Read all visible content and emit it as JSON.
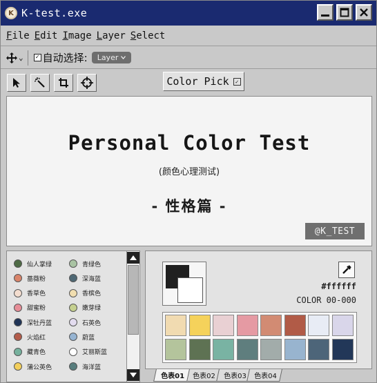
{
  "window": {
    "app_icon_letter": "K",
    "title": "K-test.exe",
    "controls": [
      "minimize",
      "maximize",
      "close"
    ]
  },
  "menu": {
    "items": [
      {
        "u": "F",
        "rest": "ile"
      },
      {
        "u": "E",
        "rest": "dit"
      },
      {
        "u": "I",
        "rest": "mage"
      },
      {
        "u": "L",
        "rest": "ayer"
      },
      {
        "u": "S",
        "rest": "elect"
      }
    ]
  },
  "options": {
    "move_caret": "⌄",
    "checkbox_mark": "✓",
    "auto_select_label": "自动选择:",
    "layer_value": "Layer"
  },
  "tools": {
    "items": [
      "pointer-icon",
      "magic-wand-icon",
      "crop-icon",
      "target-icon"
    ],
    "color_pick_label": "Color Pick"
  },
  "canvas": {
    "title": "Personal Color Test",
    "subtitle": "(颜色心理测试)",
    "chapter": "- 性格篇 -",
    "tag": "@K_TEST"
  },
  "color_list": [
    {
      "name": "仙人掌绿",
      "color": "#4d6a44"
    },
    {
      "name": "青绿色",
      "color": "#a9c3a3"
    },
    {
      "name": "蔷薇粉",
      "color": "#d9846a"
    },
    {
      "name": "深海蓝",
      "color": "#4e6874"
    },
    {
      "name": "香草色",
      "color": "#f3ddcf"
    },
    {
      "name": "香槟色",
      "color": "#f1deb0"
    },
    {
      "name": "甜蜜粉",
      "color": "#e68d97"
    },
    {
      "name": "嫩芽绿",
      "color": "#c5d08f"
    },
    {
      "name": "深牡丹蓝",
      "color": "#1f3356"
    },
    {
      "name": "石英色",
      "color": "#e3dcef"
    },
    {
      "name": "火焰红",
      "color": "#b35c4a"
    },
    {
      "name": "蔚蓝",
      "color": "#96b4d2"
    },
    {
      "name": "藏青色",
      "color": "#76b19d"
    },
    {
      "name": "艾丽斯蓝",
      "color": "#ffffff"
    },
    {
      "name": "蒲公英色",
      "color": "#f3cf5c"
    },
    {
      "name": "海洋蓝",
      "color": "#577d7d"
    }
  ],
  "swatch_panel": {
    "foreground": "#202020",
    "background": "#ffffff",
    "hex": "#ffffff",
    "color_code": "COLOR 00-000",
    "swatches": [
      "#f1dbb1",
      "#f5d25b",
      "#e9d0d3",
      "#e59aa3",
      "#d28b73",
      "#b15b47",
      "#e8ecf5",
      "#d9d6ea",
      "#b4c49c",
      "#5e7253",
      "#79b3a3",
      "#5f7e7e",
      "#a2acaa",
      "#98b4cf",
      "#4d6579",
      "#223758"
    ],
    "tabs": [
      "色表01",
      "色表02",
      "色表03",
      "色表04"
    ],
    "active_tab": 0
  }
}
